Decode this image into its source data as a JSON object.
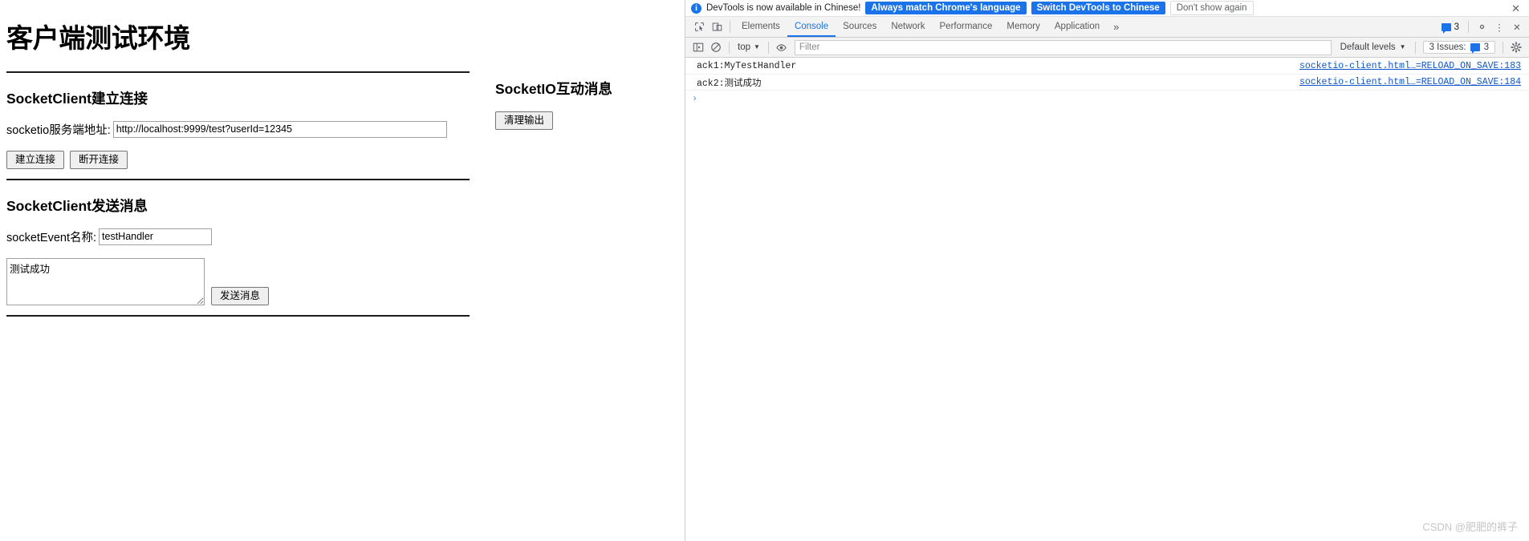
{
  "page": {
    "title": "客户端测试环境",
    "connect_section": {
      "heading": "SocketClient建立连接",
      "url_label": "socketio服务端地址:",
      "url_value": "http://localhost:9999/test?userId=12345",
      "url_placeholder": "",
      "connect_button": "建立连接",
      "disconnect_button": "断开连接"
    },
    "send_section": {
      "heading": "SocketClient发送消息",
      "event_label": "socketEvent名称:",
      "event_value": "testHandler",
      "event_placeholder": "",
      "message_value": "测试成功",
      "message_placeholder": "",
      "send_button": "发送消息"
    },
    "output_section": {
      "heading": "SocketIO互动消息",
      "clear_button": "清理输出"
    }
  },
  "devtools": {
    "infobar": {
      "icon": "info-icon",
      "text": "DevTools is now available in Chinese!",
      "primary_button": "Always match Chrome's language",
      "secondary_button": "Switch DevTools to Chinese",
      "dismiss_button": "Don't show again",
      "close_icon": "✕"
    },
    "tabbar": {
      "inspect_icon": "inspect-element-icon",
      "device_icon": "device-toolbar-icon",
      "tabs": [
        {
          "label": "Elements",
          "active": false
        },
        {
          "label": "Console",
          "active": true
        },
        {
          "label": "Sources",
          "active": false
        },
        {
          "label": "Network",
          "active": false
        },
        {
          "label": "Performance",
          "active": false
        },
        {
          "label": "Memory",
          "active": false
        },
        {
          "label": "Application",
          "active": false
        }
      ],
      "more_tabs_icon": "»",
      "issues_badge_count": "3",
      "settings_icon": "gear-icon",
      "kebab_icon": "⋮",
      "close_icon": "✕"
    },
    "console_toolbar": {
      "sidebar_icon": "console-sidebar-icon",
      "clear_icon": "clear-console-icon",
      "context": "top",
      "eye_icon": "live-expression-icon",
      "filter_placeholder": "Filter",
      "filter_value": "",
      "levels_label": "Default levels",
      "issues_label": "3 Issues:",
      "issues_count": "3",
      "settings_icon": "settings-gear-icon"
    },
    "console_messages": [
      {
        "text": "ack1:MyTestHandler",
        "source": "socketio-client.html…=RELOAD_ON_SAVE:183"
      },
      {
        "text": "ack2:测试成功",
        "source": "socketio-client.html…=RELOAD_ON_SAVE:184"
      }
    ],
    "prompt_symbol": "›"
  },
  "watermark": "CSDN @肥肥的裤子",
  "colors": {
    "accent_blue": "#1a73e8",
    "link_blue": "#1155cc",
    "toolbar_bg": "#f3f3f3",
    "border": "#cdcdcd"
  }
}
